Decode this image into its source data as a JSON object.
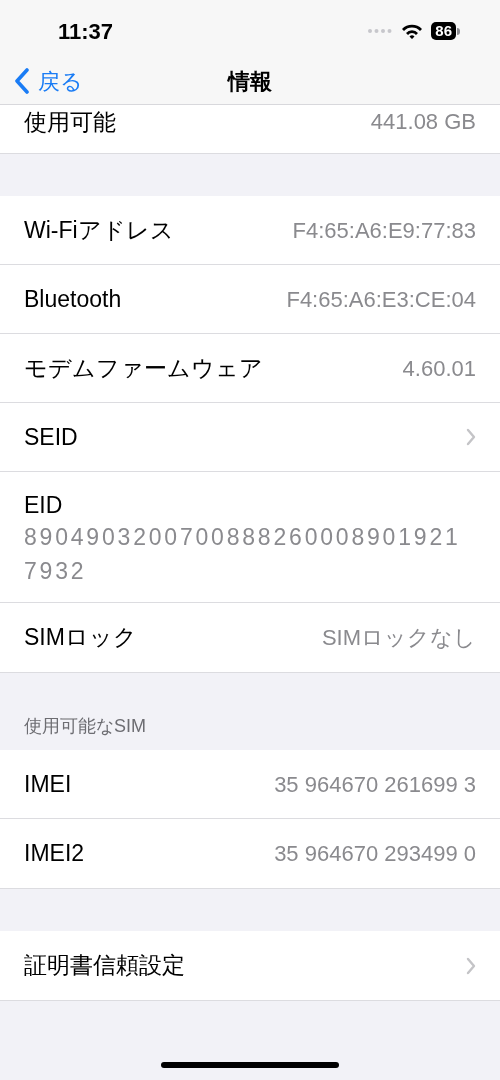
{
  "status_bar": {
    "time": "11:37",
    "battery": "86"
  },
  "nav": {
    "back": "戻る",
    "title": "情報"
  },
  "groups": [
    {
      "rows": [
        {
          "kind": "value",
          "label": "使用可能",
          "value": "441.08 GB"
        }
      ]
    },
    {
      "rows": [
        {
          "kind": "value",
          "label": "Wi-Fiアドレス",
          "value": "F4:65:A6:E9:77:83"
        },
        {
          "kind": "value",
          "label": "Bluetooth",
          "value": "F4:65:A6:E3:CE:04"
        },
        {
          "kind": "value",
          "label": "モデムファームウェア",
          "value": "4.60.01"
        },
        {
          "kind": "chevron",
          "label": "SEID"
        },
        {
          "kind": "stacked",
          "label": "EID",
          "value": "89049032007008882600089019217932"
        },
        {
          "kind": "value",
          "label": "SIMロック",
          "value": "SIMロックなし"
        }
      ]
    },
    {
      "header": "使用可能なSIM",
      "rows": [
        {
          "kind": "value",
          "label": "IMEI",
          "value": "35 964670 261699 3"
        },
        {
          "kind": "value",
          "label": "IMEI2",
          "value": "35 964670 293499 0"
        }
      ]
    },
    {
      "rows": [
        {
          "kind": "chevron",
          "label": "証明書信頼設定"
        }
      ]
    }
  ]
}
